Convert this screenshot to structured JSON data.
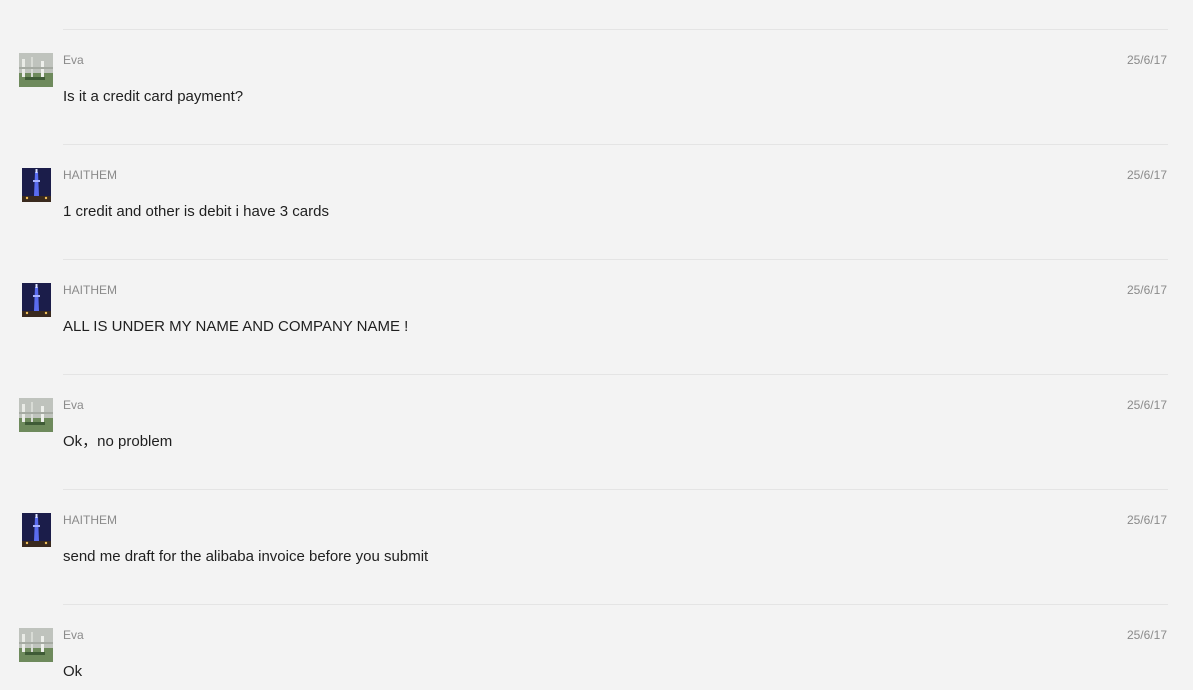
{
  "messages": [
    {
      "sender": "Eva",
      "time": "25/6/17",
      "text": "Is it a credit card payment?",
      "avatar": "eva-avatar"
    },
    {
      "sender": "HAITHEM",
      "time": "25/6/17",
      "text": "1 credit and other is debit i have 3 cards",
      "avatar": "haithem-avatar"
    },
    {
      "sender": "HAITHEM",
      "time": "25/6/17",
      "text": "ALL IS UNDER MY NAME AND COMPANY NAME !",
      "avatar": "haithem-avatar"
    },
    {
      "sender": "Eva",
      "time": "25/6/17",
      "text": "Ok，no problem",
      "avatar": "eva-avatar"
    },
    {
      "sender": "HAITHEM",
      "time": "25/6/17",
      "text": "send me draft for the alibaba invoice before you submit",
      "avatar": "haithem-avatar"
    },
    {
      "sender": "Eva",
      "time": "25/6/17",
      "text": "Ok",
      "avatar": "eva-avatar"
    }
  ]
}
